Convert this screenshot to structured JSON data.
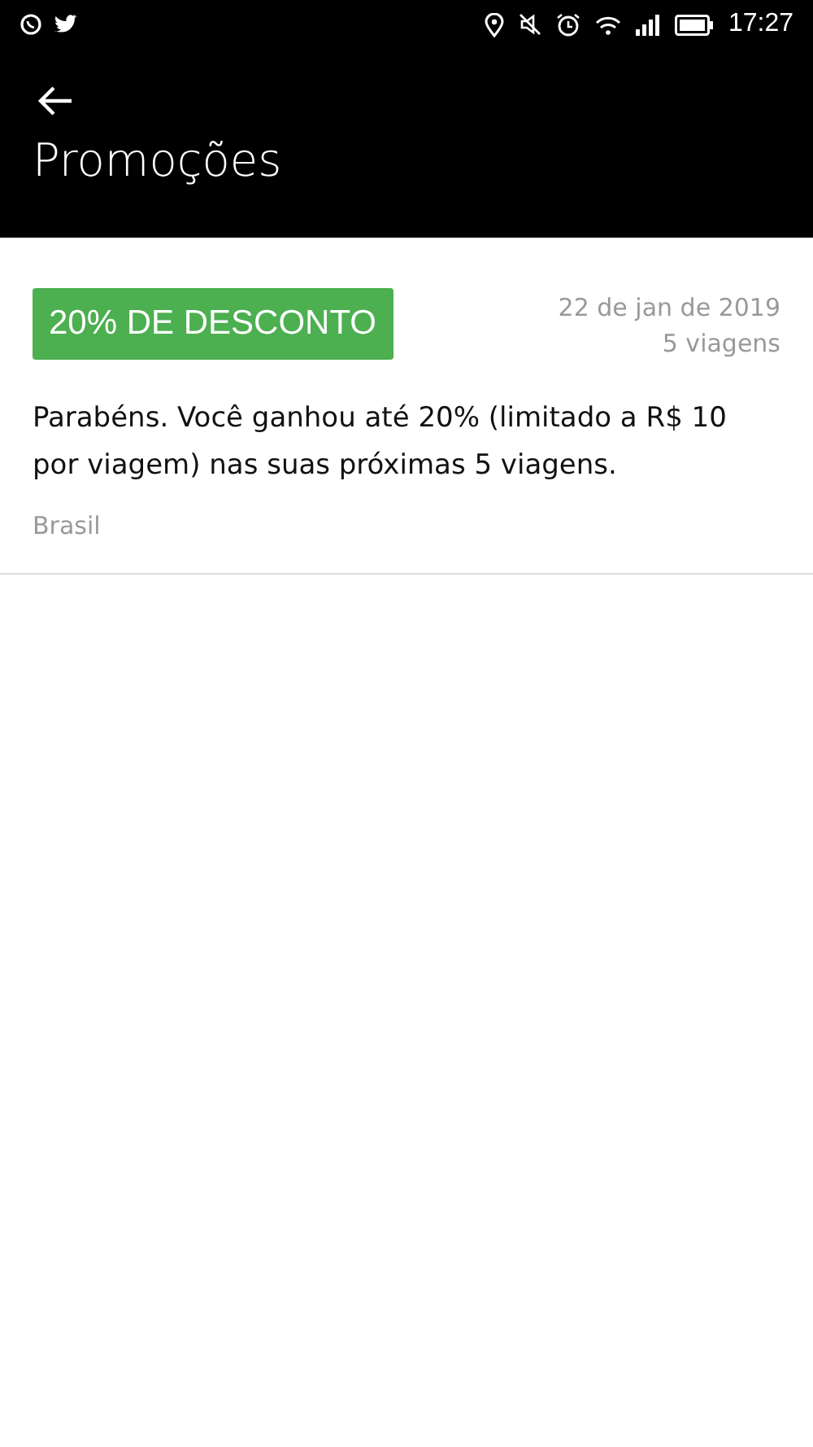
{
  "status_bar": {
    "time": "17:27"
  },
  "header": {
    "title": "Promoções"
  },
  "promotions": [
    {
      "badge": "20% DE DESCONTO",
      "date": "22 de jan de 2019",
      "trips": "5 viagens",
      "description": "Parabéns. Você ganhou até 20% (limitado a R$ 10 por viagem) nas suas próximas 5 viagens.",
      "region": "Brasil"
    }
  ]
}
